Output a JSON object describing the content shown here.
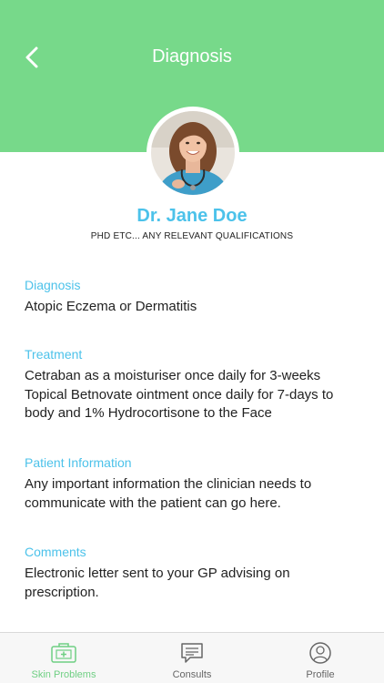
{
  "header": {
    "title": "Diagnosis",
    "back_icon": "chevron-left-icon",
    "bg_color": "#77d98a"
  },
  "doctor": {
    "name": "Dr. Jane Doe",
    "qualifications": "PHD ETC... ANY RELEVANT QUALIFICATIONS"
  },
  "sections": {
    "diagnosis": {
      "label": "Diagnosis",
      "body": "Atopic Eczema or Dermatitis"
    },
    "treatment": {
      "label": "Treatment",
      "lines": [
        "Cetraban as a moisturiser once daily for 3-weeks",
        "Topical Betnovate ointment once daily for 7-days to",
        "body and 1% Hydrocortisone to the Face"
      ]
    },
    "patient_info": {
      "label": "Patient Information",
      "lines": [
        "Any important information the clinician needs to",
        "communicate with the patient can go here."
      ]
    },
    "comments": {
      "label": "Comments",
      "lines": [
        "Electronic letter sent to your GP advising on",
        "prescription."
      ]
    }
  },
  "tabbar": {
    "tabs": [
      {
        "label": "Skin Problems",
        "icon": "first-aid-kit-icon",
        "active": true
      },
      {
        "label": "Consults",
        "icon": "chat-bubble-icon",
        "active": false
      },
      {
        "label": "Profile",
        "icon": "user-profile-icon",
        "active": false
      }
    ],
    "active_color": "#6fcf83",
    "inactive_color": "#666666"
  },
  "colors": {
    "accent": "#4cc2ea"
  }
}
